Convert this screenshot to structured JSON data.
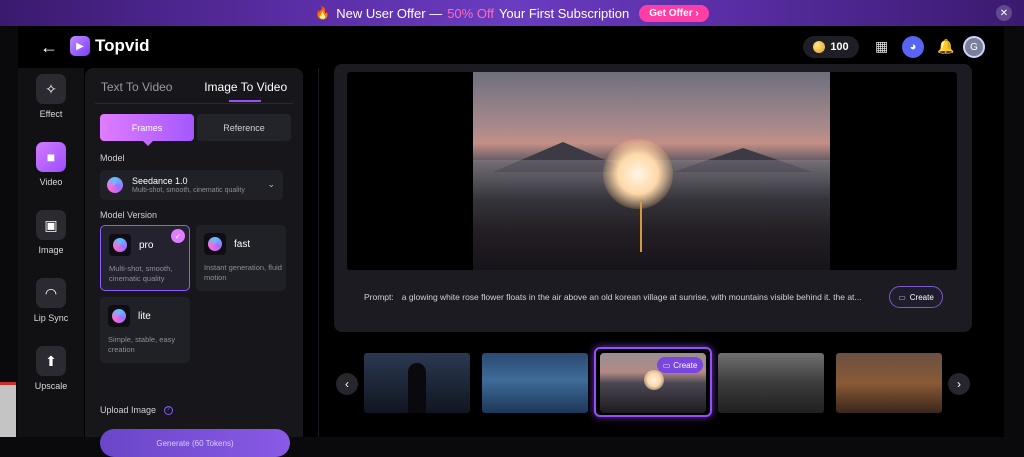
{
  "promo": {
    "fire_icon": "fire-icon",
    "text_before": "New User Offer —",
    "percent": "50% Off",
    "text_after": "Your First Subscription",
    "button": "Get Offer ›",
    "close_icon": "close-icon",
    "accent": "#ff3ea5"
  },
  "header": {
    "back_icon": "arrow-left-icon",
    "logo_text": "Topvid",
    "tokens": "100",
    "avatar_initial": "G"
  },
  "rail": {
    "items": [
      {
        "label": "Effect",
        "icon": "magic-wand-icon"
      },
      {
        "label": "Video",
        "icon": "video-icon"
      },
      {
        "label": "Image",
        "icon": "image-icon"
      },
      {
        "label": "Lip Sync",
        "icon": "lips-icon"
      },
      {
        "label": "Upscale",
        "icon": "upscale-icon"
      }
    ],
    "active": "Video"
  },
  "panel": {
    "tabs": [
      "Text To Video",
      "Image To Video"
    ],
    "active_tab": "Image To Video",
    "segments": [
      "Frames",
      "Reference"
    ],
    "active_segment": "Frames",
    "model_label": "Model",
    "model": {
      "name": "Seedance 1.0",
      "desc": "Multi-shot, smooth, cinematic quality"
    },
    "version_label": "Model Version",
    "versions": [
      {
        "name": "pro",
        "desc": "Multi-shot, smooth, cinematic quality",
        "selected": true
      },
      {
        "name": "fast",
        "desc": "Instant generation, fluid motion",
        "selected": false
      },
      {
        "name": "lite",
        "desc": "Simple, stable, easy creation",
        "selected": false
      }
    ],
    "upload_label": "Upload Image",
    "generate": "Generate (60 Tokens)"
  },
  "viewer": {
    "prompt_label": "Prompt:",
    "prompt_text": "a glowing white rose flower floats in the air above an old korean village at sunrise, with mountains visible behind it. the at...",
    "create": "Create"
  },
  "strip": {
    "thumb_create": "Create",
    "selected_index": 2
  },
  "colors": {
    "accent": "#9a4dff",
    "pink": "#e07cff",
    "bg": "#000000"
  }
}
